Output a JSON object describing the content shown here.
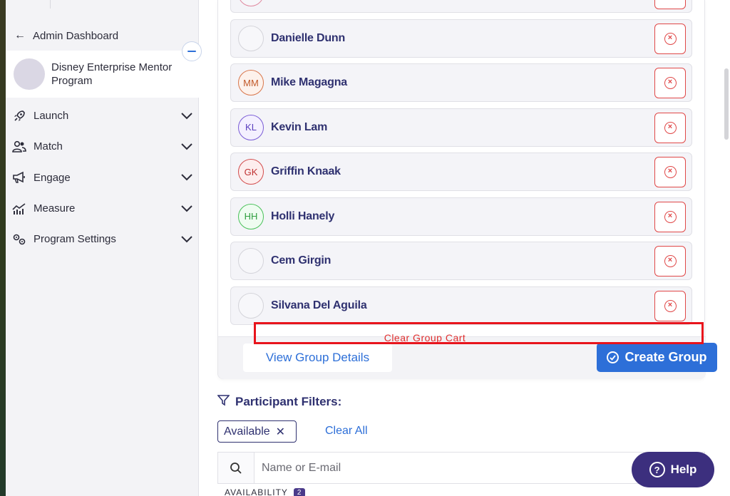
{
  "sidebar": {
    "back_label": "Admin Dashboard",
    "program_name": "Disney Enterprise Mentor Program",
    "items": [
      {
        "label": "Launch",
        "icon": "rocket-icon"
      },
      {
        "label": "Match",
        "icon": "users-icon"
      },
      {
        "label": "Engage",
        "icon": "megaphone-icon"
      },
      {
        "label": "Measure",
        "icon": "chart-icon"
      },
      {
        "label": "Program Settings",
        "icon": "gears-icon"
      }
    ]
  },
  "group_cart": {
    "participants": [
      {
        "name": "",
        "initials": ""
      },
      {
        "name": "Danielle Dunn",
        "initials": ""
      },
      {
        "name": "Mike Magagna",
        "initials": "MM"
      },
      {
        "name": "Kevin Lam",
        "initials": "KL"
      },
      {
        "name": "Griffin Knaak",
        "initials": "GK"
      },
      {
        "name": "Holli Hanely",
        "initials": "HH"
      },
      {
        "name": "Cem Girgin",
        "initials": ""
      },
      {
        "name": "Silvana Del Aguila",
        "initials": ""
      }
    ],
    "clear_label": "Clear Group Cart",
    "view_details_label": "View Group Details",
    "create_label": "Create Group"
  },
  "filters": {
    "title": "Participant Filters:",
    "chip_label": "Available",
    "clear_all_label": "Clear All",
    "search_placeholder": "Name or E-mail",
    "availability_label": "AVAILABILITY",
    "availability_count": "2"
  },
  "help_label": "Help",
  "colors": {
    "primary": "#2d6fd8",
    "danger": "#e04848",
    "navy": "#2f3170",
    "help_bg": "#3c2f7e"
  }
}
